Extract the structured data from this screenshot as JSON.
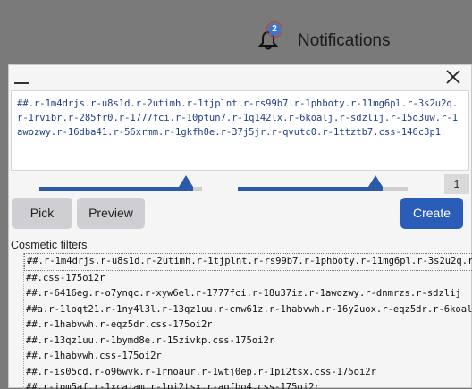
{
  "topbar": {
    "notification_count": "2",
    "notifications_label": "Notifications"
  },
  "dialog": {
    "selector_text": "##.r-1m4drjs.r-u8s1d.r-2utimh.r-1tjplnt.r-rs99b7.r-1phboty.r-11mg6pl.r-3s2u2q.r-1rvibr.r-285fr0.r-1777fci.r-10ptun7.r-1q142lx.r-6koalj.r-sdzlij.r-15o3uw.r-1awozwy.r-16dba41.r-56xrmm.r-1gkfh8e.r-37j5jr.r-qvutc0.r-1ttztb7.css-146c3p1",
    "slider1_level": 0.9,
    "slider2_level": 0.81,
    "match_count": "1",
    "pick_label": "Pick",
    "preview_label": "Preview",
    "create_label": "Create",
    "cosmetic_filters_title": "Cosmetic filters",
    "filters": [
      "##.r-1m4drjs.r-u8s1d.r-2utimh.r-1tjplnt.r-rs99b7.r-1phboty.r-11mg6pl.r-3s2u2q.r-1rvibr.r-285fr0",
      "##.css-175oi2r",
      "##.r-6416eg.r-o7ynqc.r-xyw6el.r-1777fci.r-18u37iz.r-1awozwy.r-dnmrzs.r-sdzlij",
      "##a.r-1loqt21.r-1ny4l3l.r-13qz1uu.r-cnw61z.r-1habvwh.r-16y2uox.r-eqz5dr.r-6koalj",
      "##.r-1habvwh.r-eqz5dr.css-175oi2r",
      "##.r-13qz1uu.r-1bymd8e.r-15zivkp.css-175oi2r",
      "##.r-1habvwh.css-175oi2r",
      "##.r-is05cd.r-o96wvk.r-1rnoaur.r-1wtj0ep.r-1pi2tsx.css-175oi2r",
      "##.r-ipm5af.r-1xcajam.r-1pi2tsx.r-aqfbo4.css-175oi2r"
    ],
    "colors": {
      "accent": "#2a5db7",
      "slider": "#2b5aa8"
    }
  }
}
